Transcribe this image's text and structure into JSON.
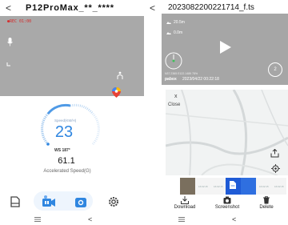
{
  "left": {
    "header": {
      "back_glyph": "<",
      "title": "P12ProMax_**_****"
    },
    "camera": {
      "rec_text": "●REC 01:00"
    },
    "gauge": {
      "speed_label": "Speed(KM/H)",
      "speed": "23",
      "ws_label": "WS 187°",
      "accel_value": "61.1",
      "accel_label": "Accelerated Speed(G)"
    },
    "bottom_nav": [
      "file-icon",
      "video-record-icon",
      "camera-icon",
      "settings-icon"
    ],
    "system_nav": {
      "back_glyph": "<"
    }
  },
  "right": {
    "header": {
      "back_glyph": "<",
      "title": "2023082200221714_f.ts"
    },
    "video": {
      "stat_1": "20.5m",
      "stat_2": "0.0m",
      "small_text": "N37.2365 E122.1489 78%",
      "brand": "pabox",
      "datetime": "2023/04/22 00:22:18",
      "speed_bubble": "2"
    },
    "map": {
      "close_x": "x",
      "close_label": "Close"
    },
    "thumbnails": [
      "16:02:15",
      "16:02:15",
      "16:02:15",
      "16:02:15",
      "16:02:15"
    ],
    "actions": {
      "download": "Download",
      "screenshot": "Screenshot",
      "delete": "Delete"
    },
    "system_nav": {
      "back_glyph": "<"
    }
  },
  "colors": {
    "accent_blue": "#2f86e0",
    "camera_gray": "#a9a9a9",
    "rec_red": "#d52b2b"
  }
}
